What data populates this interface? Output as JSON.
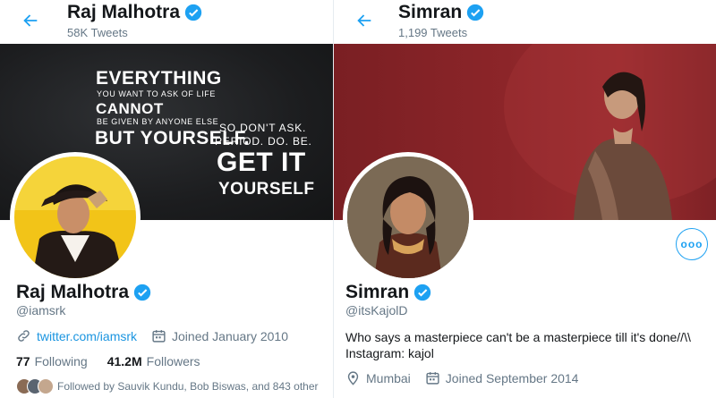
{
  "left_profile": {
    "header_name": "Raj Malhotra",
    "tweet_count": "58K Tweets",
    "name": "Raj Malhotra",
    "handle": "@iamsrk",
    "website": "twitter.com/iamsrk",
    "joined": "Joined January 2010",
    "following_count": "77",
    "following_label": "Following",
    "followers_count": "41.2M",
    "followers_label": "Followers",
    "followed_by": "Followed by Sauvik Kundu, Bob Biswas, and 843 other",
    "banner_quote": {
      "line1": "EVERYTHING",
      "line2": "YOU WANT TO ASK OF LIFE",
      "line3": "CANNOT",
      "line4": "BE GIVEN BY ANYONE ELSE",
      "line5": "BUT YOURSELF.",
      "line6": "SO DON'T ASK.",
      "line7": "PERIOD. DO. BE.",
      "line8": "GET IT",
      "line9": "YOURSELF"
    }
  },
  "right_profile": {
    "header_name": "Simran",
    "tweet_count": "1,199 Tweets",
    "name": "Simran",
    "handle": "@itsKajolD",
    "bio_line1": "Who says a masterpiece can't be a masterpiece till it's done//\\\\",
    "bio_line2": "Instagram: kajol",
    "location": "Mumbai",
    "joined": "Joined September 2014",
    "more_label": "ooo"
  },
  "colors": {
    "accent": "#1da1f2",
    "link": "#1b95e0",
    "muted": "#657786",
    "banner_right": "#8c2529"
  },
  "icons": [
    "back-arrow-icon",
    "verified-badge-icon",
    "link-icon",
    "calendar-icon",
    "location-pin-icon",
    "more-options-icon"
  ]
}
